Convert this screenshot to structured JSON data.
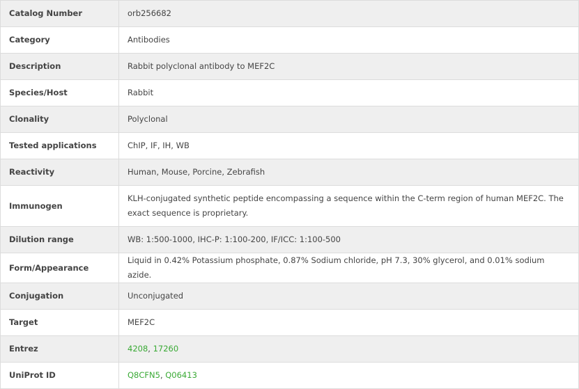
{
  "rows": [
    {
      "label": "Catalog Number",
      "value": "orb256682"
    },
    {
      "label": "Category",
      "value": "Antibodies"
    },
    {
      "label": "Description",
      "value": "Rabbit polyclonal antibody to MEF2C"
    },
    {
      "label": "Species/Host",
      "value": "Rabbit"
    },
    {
      "label": "Clonality",
      "value": "Polyclonal"
    },
    {
      "label": "Tested applications",
      "value": "ChIP, IF, IH, WB"
    },
    {
      "label": "Reactivity",
      "value": "Human, Mouse, Porcine, Zebrafish"
    },
    {
      "label": "Immunogen",
      "value": "KLH-conjugated synthetic peptide encompassing a sequence within the C-term region of human MEF2C. The exact sequence is proprietary."
    },
    {
      "label": "Dilution range",
      "value": "WB: 1:500-1000, IHC-P: 1:100-200, IF/ICC: 1:100-500"
    },
    {
      "label": "Form/Appearance",
      "value": "Liquid in 0.42% Potassium phosphate, 0.87% Sodium chloride, pH 7.3, 30% glycerol, and 0.01% sodium azide."
    },
    {
      "label": "Conjugation",
      "value": "Unconjugated"
    },
    {
      "label": "Target",
      "value": "MEF2C"
    },
    {
      "label": "Entrez",
      "links": [
        "4208",
        "17260"
      ]
    },
    {
      "label": "UniProt ID",
      "links": [
        "Q8CFN5",
        "Q06413"
      ]
    }
  ],
  "link_color": "#3aaa35",
  "separator": ", "
}
